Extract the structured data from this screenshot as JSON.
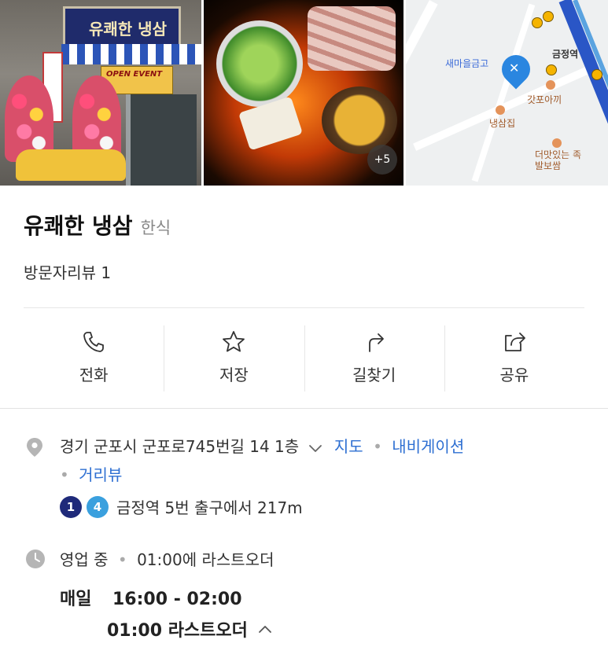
{
  "photos": {
    "storefront_sign": "유쾌한 냉삼",
    "event_banner": "OPEN EVENT",
    "more_count": "+5",
    "map_labels": {
      "bank": "새마을금고",
      "station": "금정역",
      "poi_1": "갓포아끼",
      "poi_2": "냉삼집",
      "poi_3": "더맛있는 족발보쌈"
    }
  },
  "place": {
    "name": "유쾌한 냉삼",
    "category": "한식",
    "reviews": "방문자리뷰 1"
  },
  "actions": [
    {
      "label": "전화",
      "icon": "phone-icon"
    },
    {
      "label": "저장",
      "icon": "star-icon"
    },
    {
      "label": "길찾기",
      "icon": "directions-icon"
    },
    {
      "label": "공유",
      "icon": "share-icon"
    }
  ],
  "address": {
    "text": "경기 군포시 군포로745번길 14 1층",
    "links": {
      "map": "지도",
      "navigation": "내비게이션",
      "streetview": "거리뷰"
    }
  },
  "subway": {
    "lines": [
      "1",
      "4"
    ],
    "text": "금정역 5번 출구에서 217m"
  },
  "hours": {
    "status": "영업 중",
    "summary": "01:00에 라스트오더",
    "day": "매일",
    "time": "16:00 - 02:00",
    "last_order": "01:00 라스트오더"
  },
  "colors": {
    "link": "#2e6fd2",
    "line1": "#1f2a7a",
    "line4": "#3aa0de"
  }
}
